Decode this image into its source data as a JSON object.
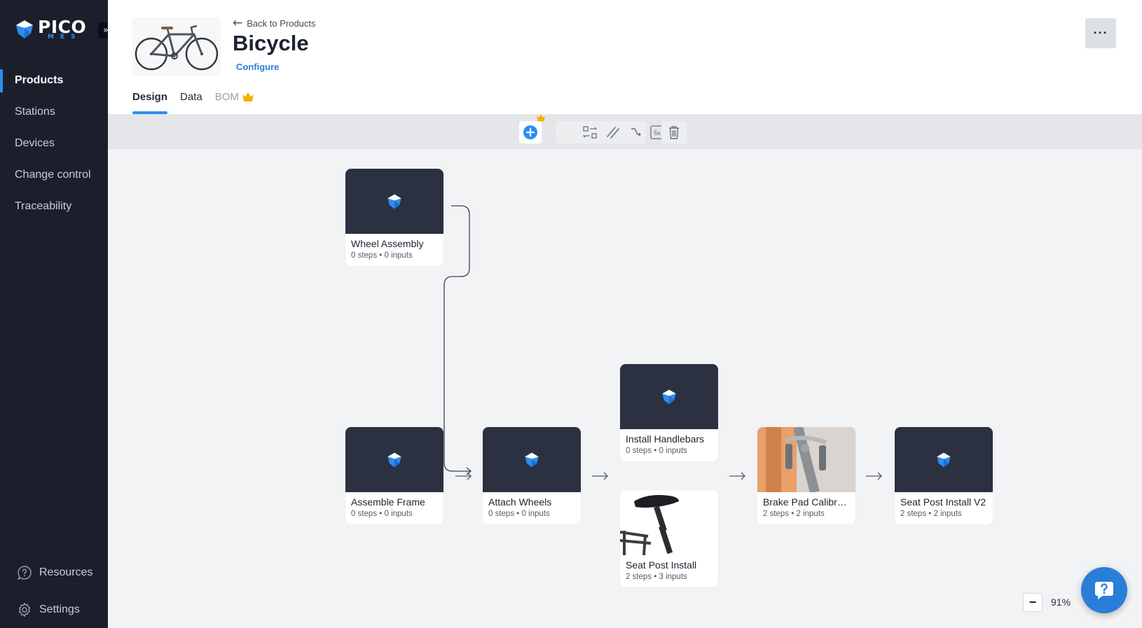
{
  "app": {
    "logo_main": "PICO",
    "logo_sub": "MES",
    "collapse_glyph": "»"
  },
  "sidebar": {
    "items": [
      {
        "label": "Products",
        "active": true
      },
      {
        "label": "Stations"
      },
      {
        "label": "Devices"
      },
      {
        "label": "Change control"
      },
      {
        "label": "Traceability"
      }
    ],
    "bottom": [
      {
        "label": "Resources",
        "icon": "question-bubble-icon"
      },
      {
        "label": "Settings",
        "icon": "gear-icon"
      }
    ]
  },
  "header": {
    "back_label": "Back to Products",
    "title": "Bicycle",
    "configure_label": "Configure",
    "more_label": "···",
    "tabs": [
      {
        "label": "Design",
        "active": true
      },
      {
        "label": "Data"
      },
      {
        "label": "BOM",
        "premium": true
      }
    ]
  },
  "toolbar": {
    "tools": [
      "add-node-icon",
      "swap-icon",
      "parallel-icon",
      "connector-icon",
      "multiply-icon",
      "trash-icon"
    ],
    "multiply_label": "5x"
  },
  "nodes": [
    {
      "name": "Wheel Assembly",
      "meta": "0 steps • 0 inputs"
    },
    {
      "name": "Assemble Frame",
      "meta": "0 steps • 0 inputs"
    },
    {
      "name": "Attach Wheels",
      "meta": "0 steps • 0 inputs"
    },
    {
      "name": "Install Handlebars",
      "meta": "0 steps • 0 inputs"
    },
    {
      "name": "Seat Post Install",
      "meta": "2 steps • 3 inputs"
    },
    {
      "name": "Brake Pad Calibra...",
      "meta": "2 steps • 2 inputs"
    },
    {
      "name": "Seat Post Install V2",
      "meta": "2 steps • 2 inputs"
    }
  ],
  "zoom": {
    "minus_label": "−",
    "level": "91%"
  },
  "colors": {
    "sidebar_bg": "#1b1f2b",
    "accent": "#2e8df2",
    "node_image_bg": "#2b3140",
    "canvas_bg": "#f1f3f5",
    "premium_gold": "#f0b400"
  }
}
